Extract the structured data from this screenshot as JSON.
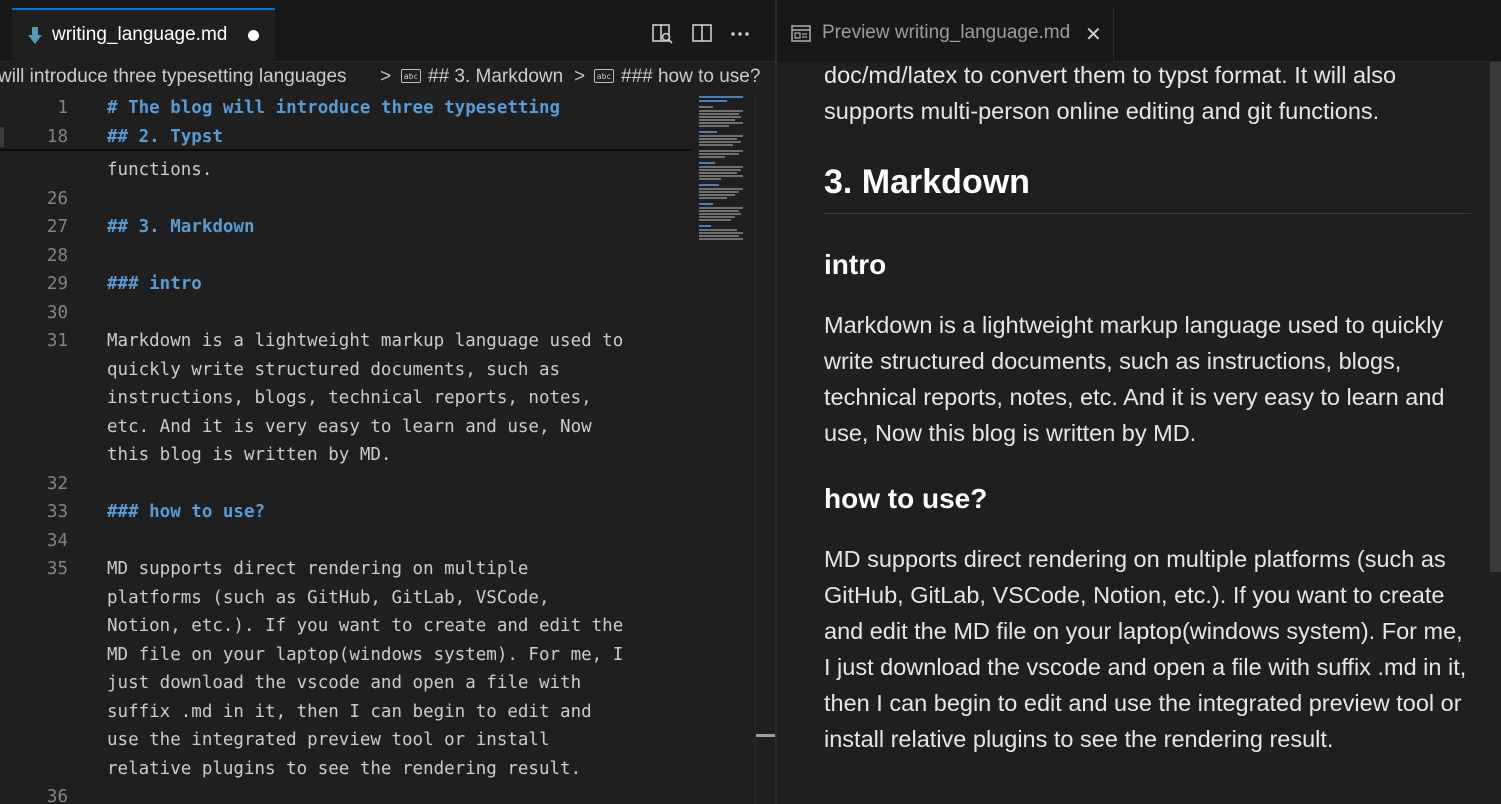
{
  "editor": {
    "tab_title": "writing_language.md",
    "breadcrumb": {
      "item1": "will introduce three typesetting languages",
      "sep": ">",
      "symbol_icon_text": "abc",
      "item2": "## 3. Markdown",
      "item3": "### how to use?"
    },
    "sticky_lines": [
      {
        "num": "1",
        "text": "# The blog will introduce three typesetting"
      },
      {
        "num": "18",
        "text": "## 2. Typst"
      }
    ],
    "lines": [
      {
        "num": "",
        "text": "functions."
      },
      {
        "num": "26",
        "text": ""
      },
      {
        "num": "27",
        "text": "## 3. Markdown"
      },
      {
        "num": "28",
        "text": ""
      },
      {
        "num": "29",
        "text": "### intro"
      },
      {
        "num": "30",
        "text": ""
      },
      {
        "num": "31",
        "text": "Markdown is a lightweight markup language used to"
      },
      {
        "num": "",
        "text": "quickly write structured documents, such as"
      },
      {
        "num": "",
        "text": "instructions, blogs, technical reports, notes,"
      },
      {
        "num": "",
        "text": "etc. And it is very easy to learn and use, Now"
      },
      {
        "num": "",
        "text": "this blog is written by MD."
      },
      {
        "num": "32",
        "text": ""
      },
      {
        "num": "33",
        "text": "### how to use?"
      },
      {
        "num": "34",
        "text": ""
      },
      {
        "num": "35",
        "text": "MD supports direct rendering on multiple"
      },
      {
        "num": "",
        "text": "platforms (such as GitHub, GitLab, VSCode,"
      },
      {
        "num": "",
        "text": "Notion, etc.). If you want to create and edit the"
      },
      {
        "num": "",
        "text": "MD file on your laptop(windows system). For me, I"
      },
      {
        "num": "",
        "text": "just download the vscode and open a file with"
      },
      {
        "num": "",
        "text": "suffix .md in it, then I can begin to edit and"
      },
      {
        "num": "",
        "text": "use the integrated preview tool or install"
      },
      {
        "num": "",
        "text": "relative plugins to see the rendering result."
      },
      {
        "num": "36",
        "text": ""
      }
    ]
  },
  "preview": {
    "tab_title": "Preview writing_language.md",
    "close_glyph": "✕",
    "para_top": "doc/md/latex to convert them to typst format. It will also supports multi-person online editing and git functions.",
    "h2": "3. Markdown",
    "h3_intro": "intro",
    "para_intro": "Markdown is a lightweight markup language used to quickly write structured documents, such as instructions, blogs, technical reports, notes, etc. And it is very easy to learn and use, Now this blog is written by MD.",
    "h3_how": "how to use?",
    "para_how": "MD supports direct rendering on multiple platforms (such as GitHub, GitLab, VSCode, Notion, etc.). If you want to create and edit the MD file on your laptop(windows system). For me, I just download the vscode and open a file with suffix .md in it, then I can begin to edit and use the integrated preview tool or install relative plugins to see the rendering result."
  },
  "colors": {
    "accent": "#0078d4",
    "heading_code": "#569cd6",
    "md_icon": "#519aba"
  }
}
